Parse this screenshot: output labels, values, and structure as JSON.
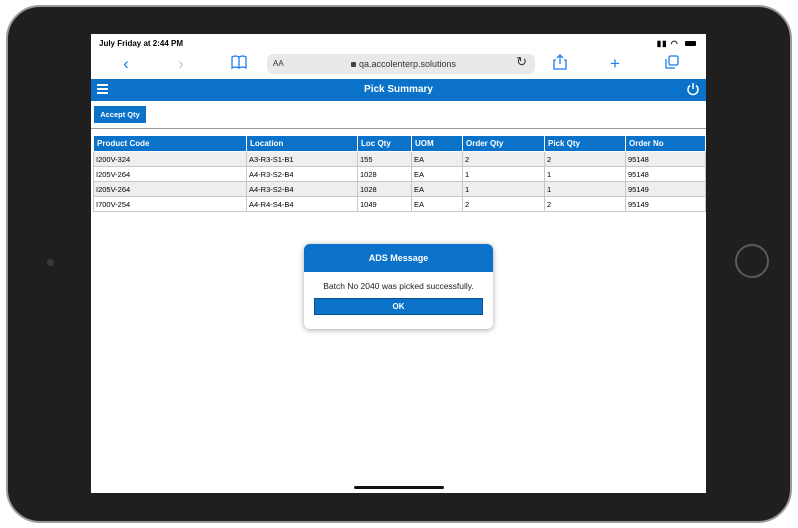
{
  "status": {
    "time": "July Friday at 2:44 PM"
  },
  "browser": {
    "aa_label": "AA",
    "url": "qa.accolenterp.solutions"
  },
  "app": {
    "title": "Pick Summary"
  },
  "actions": {
    "accept_label": "Accept Qty"
  },
  "table": {
    "headers": [
      "Product Code",
      "Location",
      "Loc Qty",
      "UOM",
      "Order Qty",
      "Pick Qty",
      "Order No"
    ],
    "rows": [
      [
        "I200V-324",
        "A3-R3-S1-B1",
        "155",
        "EA",
        "2",
        "2",
        "95148"
      ],
      [
        "I205V-264",
        "A4-R3-S2-B4",
        "1028",
        "EA",
        "1",
        "1",
        "95148"
      ],
      [
        "I205V-264",
        "A4-R3-S2-B4",
        "1028",
        "EA",
        "1",
        "1",
        "95149"
      ],
      [
        "I700V-254",
        "A4-R4-S4-B4",
        "1049",
        "EA",
        "2",
        "2",
        "95149"
      ]
    ]
  },
  "dialog": {
    "title": "ADS Message",
    "message": "Batch No 2040 was picked successfully.",
    "ok_label": "OK"
  },
  "icons": [
    "back-icon",
    "forward-icon",
    "bookmarks-icon",
    "lock-icon",
    "reload-icon",
    "share-icon",
    "plus-icon",
    "tabs-icon",
    "menu-icon",
    "power-icon"
  ],
  "colors": {
    "primary": "#0a72c9",
    "row_alt": "#eeeeee"
  }
}
